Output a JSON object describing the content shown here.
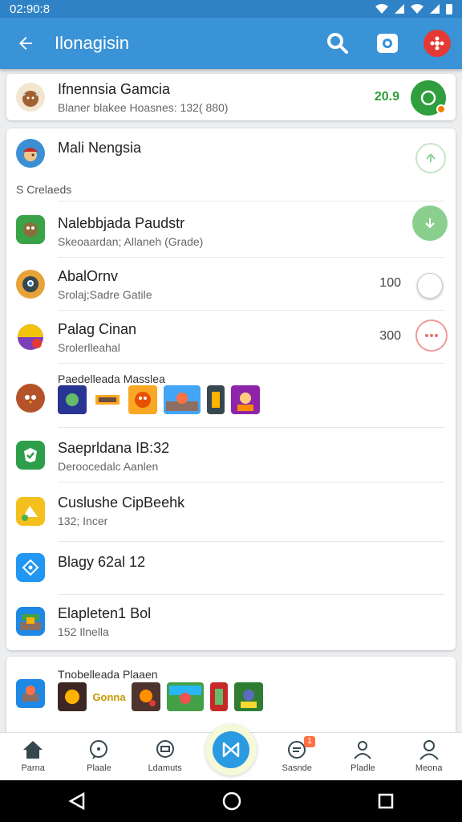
{
  "status": {
    "time": "02:90:8"
  },
  "appbar": {
    "title": "Ilonagisin"
  },
  "top_item": {
    "title": "Ifnennsia Gamcia",
    "subtitle": "Blaner blakee  Hoasnes: 132( 880)",
    "value": "20.9",
    "value_color": "#2e9e3e"
  },
  "section": {
    "header_title": "Mali Nengsia",
    "label": "S Crelaeds",
    "items": [
      {
        "title": "Nalebbjada Paudstr",
        "subtitle": "Skeoaardan; Allaneh (Grade)",
        "value": ""
      },
      {
        "title": "AbalOrnv",
        "subtitle": "Srolaj;Sadre Gatile",
        "value": "100"
      },
      {
        "title": "Palag Cinan",
        "subtitle": "Srolerlleahal",
        "value": "300"
      }
    ],
    "gallery_title": "Paedelleada Masslea",
    "list": [
      {
        "title": "Saeprldana IB:32",
        "subtitle": "Deroocedalc Aanlen"
      },
      {
        "title": "Cuslushe CipBeehk",
        "subtitle": "132; Incer"
      },
      {
        "title": "Blagy 62al 12",
        "subtitle": ""
      },
      {
        "title": "Elapleten1 Bol",
        "subtitle": "152  Ilnella"
      }
    ]
  },
  "bottom_card": {
    "title": "Tnobelleada Plaaen",
    "thumb_label": "Gonna"
  },
  "bottom_nav": [
    {
      "label": "Parna",
      "icon": "home-icon"
    },
    {
      "label": "Plaale",
      "icon": "chat-icon"
    },
    {
      "label": "Ldamuts",
      "icon": "message-icon"
    },
    {
      "label": "",
      "icon": "bowtie-icon"
    },
    {
      "label": "Sasnde",
      "icon": "notes-icon",
      "badge": "1"
    },
    {
      "label": "Pladle",
      "icon": "people-icon"
    },
    {
      "label": "Meona",
      "icon": "profile-icon"
    }
  ],
  "colors": {
    "primary": "#3a93d6",
    "statusbar": "#2f82c6",
    "green": "#2e9e3e",
    "red": "#e53935"
  }
}
